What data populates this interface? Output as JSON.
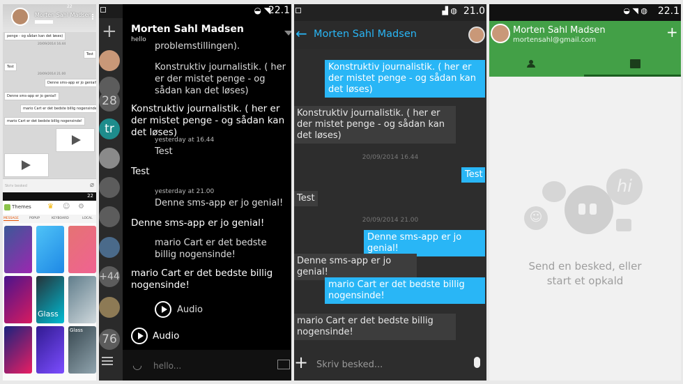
{
  "p1": {
    "contact": "Morten Sahl Madsen",
    "messages": [
      {
        "text": "penge - og sådan kan det løses)"
      },
      {
        "text": "20/09/2014 16.44",
        "ts": true
      },
      {
        "text": "Test"
      },
      {
        "text": "Test"
      },
      {
        "text": "20/09/2014 21.00",
        "ts": true
      },
      {
        "text": "Denne sms-app er jo genial!"
      },
      {
        "text": "Denne sms-app er jo genial!"
      },
      {
        "text": "mario Cart er det bedste billig nogensinde!"
      },
      {
        "text": "mario Cart er det bedste billig nogensinde!"
      }
    ],
    "input_placeholder": "Skriv besked",
    "status_time": "22",
    "themes_title": "Themes",
    "themes_tabs": [
      "MESSAGE",
      "POPUP",
      "KEYBOARD",
      "LOCAL"
    ],
    "tile_labels": [
      "Glass",
      "Glass"
    ]
  },
  "p2": {
    "contact": "Morten Sahl Madsen",
    "subtitle": "hello",
    "status_time": "22.1",
    "side_badges": [
      "28",
      "tr",
      "+44",
      "76"
    ],
    "fragment": "problemstillingen).",
    "messages": [
      {
        "kind": "in",
        "text": "Konstruktiv journalistik. ( her er der mistet penge - og sådan kan det løses)"
      },
      {
        "kind": "out",
        "text": "Konstruktiv journalistik. ( her er der mistet penge - og sådan kan det løses)"
      },
      {
        "kind": "ts",
        "text": "yesterday at 16.44"
      },
      {
        "kind": "in",
        "text": "Test"
      },
      {
        "kind": "out",
        "text": "Test"
      },
      {
        "kind": "ts",
        "text": "yesterday at 21.00"
      },
      {
        "kind": "in",
        "text": "Denne sms-app er jo genial!"
      },
      {
        "kind": "out",
        "text": "Denne sms-app er jo genial!"
      },
      {
        "kind": "in",
        "text": "mario Cart er det bedste billig nogensinde!"
      },
      {
        "kind": "out",
        "text": "mario Cart er det bedste billig nogensinde!"
      }
    ],
    "audio_in": "Audio",
    "audio_out": "Audio",
    "input_placeholder": "hello..."
  },
  "p3": {
    "contact": "Morten Sahl Madsen",
    "status_time": "21.0",
    "messages": [
      {
        "text": "Konstruktiv journalistik. ( her er der mistet penge - og sådan kan det løses)"
      },
      {
        "text": "Konstruktiv journalistik. ( her er der mistet penge - og sådan kan det løses)"
      },
      {
        "text": "20/09/2014 16.44"
      },
      {
        "text": "Test"
      },
      {
        "text": "Test"
      },
      {
        "text": "20/09/2014 21.00"
      },
      {
        "text": "Denne sms-app er jo genial!"
      },
      {
        "text": "Denne sms-app er jo genial!"
      },
      {
        "text": "mario Cart er det bedste billig nogensinde!"
      },
      {
        "text": "mario Cart er det bedste billig nogensinde!"
      }
    ],
    "input_placeholder": "Skriv besked..."
  },
  "p4": {
    "status_time": "22.1",
    "contact": "Morten Sahl Madsen",
    "email": "mortensahl@gmail.com",
    "empty_line1": "Send en besked, eller",
    "empty_line2": "start et opkald",
    "bubble_text": "hi"
  },
  "colors": {
    "accent_blue": "#29b6f6",
    "hangouts_green": "#43a047"
  }
}
